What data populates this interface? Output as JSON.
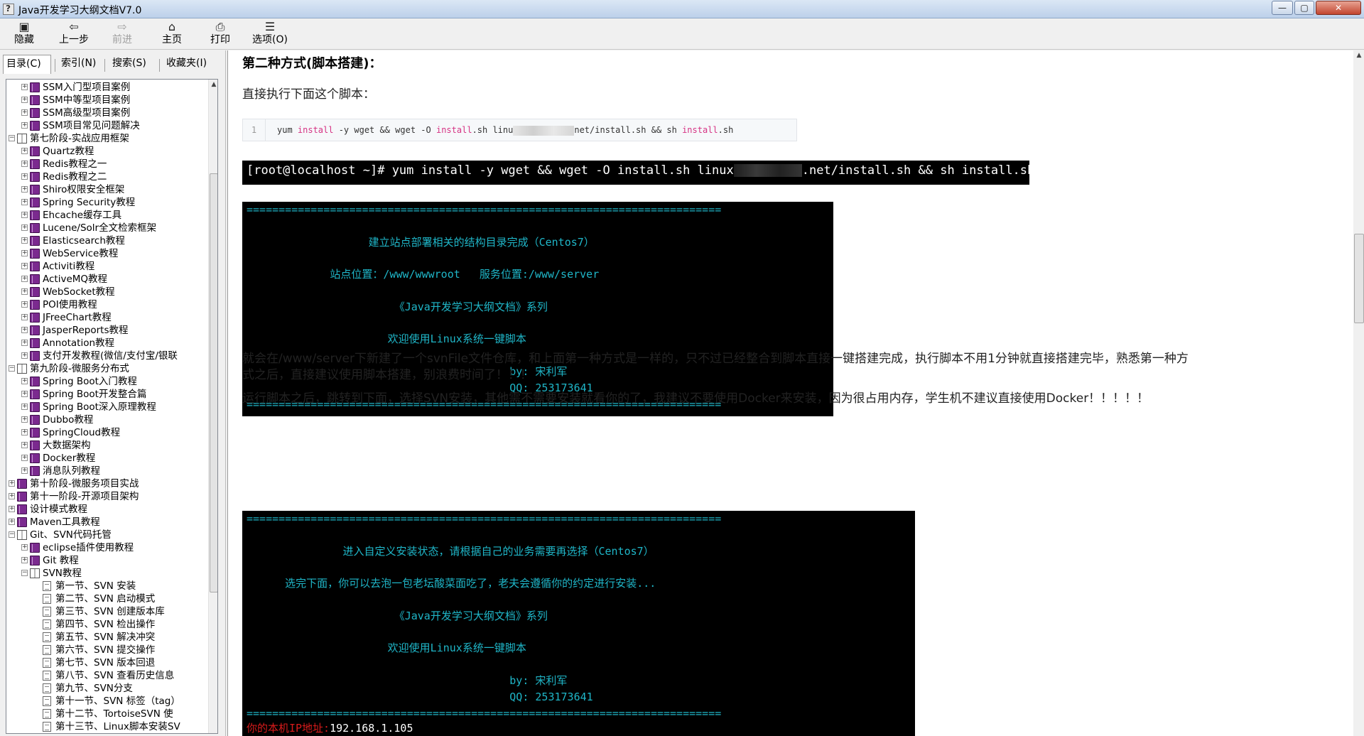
{
  "window": {
    "title": "Java开发学习大纲文档V7.0",
    "min_glyph": "—",
    "max_glyph": "▢",
    "close_glyph": "✕"
  },
  "toolbar": {
    "hide": "隐藏",
    "back": "上一步",
    "forward": "前进",
    "home": "主页",
    "print": "打印",
    "options": "选项(O)"
  },
  "nav_tabs": {
    "contents": "目录(C)",
    "index": "索引(N)",
    "search": "搜索(S)",
    "favorites": "收藏夹(I)"
  },
  "tree": [
    {
      "label": "SSM入门型项目案例",
      "level": 2,
      "icon": "book-closed"
    },
    {
      "label": "SSM中等型项目案例",
      "level": 2,
      "icon": "book-closed"
    },
    {
      "label": "SSM高级型项目案例",
      "level": 2,
      "icon": "book-closed"
    },
    {
      "label": "SSM项目常见问题解决",
      "level": 2,
      "icon": "book-closed"
    },
    {
      "label": "第七阶段-实战应用框架",
      "level": 1,
      "icon": "book-open"
    },
    {
      "label": "Quartz教程",
      "level": 2,
      "icon": "book-closed"
    },
    {
      "label": "Redis教程之一",
      "level": 2,
      "icon": "book-closed"
    },
    {
      "label": "Redis教程之二",
      "level": 2,
      "icon": "book-closed"
    },
    {
      "label": "Shiro权限安全框架",
      "level": 2,
      "icon": "book-closed"
    },
    {
      "label": "Spring Security教程",
      "level": 2,
      "icon": "book-closed"
    },
    {
      "label": "Ehcache缓存工具",
      "level": 2,
      "icon": "book-closed"
    },
    {
      "label": "Lucene/Solr全文检索框架",
      "level": 2,
      "icon": "book-closed"
    },
    {
      "label": "Elasticsearch教程",
      "level": 2,
      "icon": "book-closed"
    },
    {
      "label": "WebService教程",
      "level": 2,
      "icon": "book-closed"
    },
    {
      "label": "Activiti教程",
      "level": 2,
      "icon": "book-closed"
    },
    {
      "label": "ActiveMQ教程",
      "level": 2,
      "icon": "book-closed"
    },
    {
      "label": "WebSocket教程",
      "level": 2,
      "icon": "book-closed"
    },
    {
      "label": "POI使用教程",
      "level": 2,
      "icon": "book-closed"
    },
    {
      "label": "JFreeChart教程",
      "level": 2,
      "icon": "book-closed"
    },
    {
      "label": "JasperReports教程",
      "level": 2,
      "icon": "book-closed"
    },
    {
      "label": "Annotation教程",
      "level": 2,
      "icon": "book-closed"
    },
    {
      "label": "支付开发教程(微信/支付宝/银联",
      "level": 2,
      "icon": "book-closed"
    },
    {
      "label": "第九阶段-微服务分布式",
      "level": 1,
      "icon": "book-open"
    },
    {
      "label": "Spring Boot入门教程",
      "level": 2,
      "icon": "book-closed"
    },
    {
      "label": "Spring Boot开发整合篇",
      "level": 2,
      "icon": "book-closed"
    },
    {
      "label": "Spring Boot深入原理教程",
      "level": 2,
      "icon": "book-closed"
    },
    {
      "label": "Dubbo教程",
      "level": 2,
      "icon": "book-closed"
    },
    {
      "label": "SpringCloud教程",
      "level": 2,
      "icon": "book-closed"
    },
    {
      "label": "大数据架构",
      "level": 2,
      "icon": "book-closed"
    },
    {
      "label": "Docker教程",
      "level": 2,
      "icon": "book-closed"
    },
    {
      "label": "消息队列教程",
      "level": 2,
      "icon": "book-closed"
    },
    {
      "label": "第十阶段-微服务项目实战",
      "level": 1,
      "icon": "book-closed"
    },
    {
      "label": "第十一阶段-开源项目架构",
      "level": 1,
      "icon": "book-closed"
    },
    {
      "label": "设计模式教程",
      "level": 1,
      "icon": "book-closed"
    },
    {
      "label": "Maven工具教程",
      "level": 1,
      "icon": "book-closed"
    },
    {
      "label": "Git、SVN代码托管",
      "level": 1,
      "icon": "book-open"
    },
    {
      "label": "eclipse插件使用教程",
      "level": 2,
      "icon": "book-closed"
    },
    {
      "label": "Git 教程",
      "level": 2,
      "icon": "book-closed"
    },
    {
      "label": "SVN教程",
      "level": 2,
      "icon": "book-open"
    },
    {
      "label": "第一节、SVN 安装",
      "level": 3,
      "icon": "page"
    },
    {
      "label": "第二节、SVN 启动模式",
      "level": 3,
      "icon": "page"
    },
    {
      "label": "第三节、SVN 创建版本库",
      "level": 3,
      "icon": "page"
    },
    {
      "label": "第四节、SVN 检出操作",
      "level": 3,
      "icon": "page"
    },
    {
      "label": "第五节、SVN 解决冲突",
      "level": 3,
      "icon": "page"
    },
    {
      "label": "第六节、SVN 提交操作",
      "level": 3,
      "icon": "page"
    },
    {
      "label": "第七节、SVN 版本回退",
      "level": 3,
      "icon": "page"
    },
    {
      "label": "第八节、SVN 查看历史信息",
      "level": 3,
      "icon": "page"
    },
    {
      "label": "第九节、SVN分支",
      "level": 3,
      "icon": "page"
    },
    {
      "label": "第十一节、SVN 标签（tag）",
      "level": 3,
      "icon": "page"
    },
    {
      "label": "第十二节、TortoiseSVN 使",
      "level": 3,
      "icon": "page"
    },
    {
      "label": "第十三节、Linux脚本安装SV",
      "level": 3,
      "icon": "page"
    }
  ],
  "content": {
    "heading": "第二种方式(脚本搭建)：",
    "intro": "直接执行下面这个脚本：",
    "code": {
      "line_number": "1",
      "p1": "yum ",
      "k1": "install",
      "p2": " -y wget && wget -O ",
      "k2": "install",
      "p3": ".sh linu",
      "p4": "net/install.sh && sh ",
      "k3": "install",
      "p5": ".sh"
    },
    "cmd": {
      "left": "[root@localhost ~]# yum install -y wget && wget -O install.sh linux",
      "right": ".net/install.sh && sh install.sh",
      "cut_line": "..."
    },
    "term1": [
      "==========================================================================",
      "",
      "                   建立站点部署相关的结构目录完成（Centos7）",
      "",
      "             站点位置：/www/wwwroot   服务位置:/www/server",
      "",
      "                       《Java开发学习大纲文档》系列",
      "",
      "                      欢迎使用Linux系统一键脚本",
      "",
      "                                         by: 宋利军",
      "                                         QQ: 253173641",
      "=========================================================================="
    ],
    "para1_line1": "就会在/www/server下新建了一个svnFile文件仓库，和上面第一种方式是一样的，只不过已经整合到脚本直接一键搭建完成，执行脚本不用1分钟就直接搭建完毕，熟悉第一种方",
    "para1_line2": "式之后，直接建议使用脚本搭建，别浪费时间了！！！",
    "para2": "运行脚本之后，跳转到下面，选择SVN安装，其他需不需要安装就看你的了，我建议不要使用Docker来安装，因为很占用内存，学生机不建议直接使用Docker！！！！！",
    "term2": [
      "==========================================================================",
      "",
      "               进入自定义安装状态，请根据自己的业务需要再选择（Centos7）",
      "",
      "      选完下面，你可以去泡一包老坛酸菜面吃了，老夫会遵循你的约定进行安装...",
      "",
      "                       《Java开发学习大纲文档》系列",
      "",
      "                      欢迎使用Linux系统一键脚本",
      "",
      "                                         by: 宋利军",
      "                                         QQ: 253173641",
      "==========================================================================",
      ""
    ],
    "term2_ip_label": "你的本机IP地址:",
    "term2_ip_value": "192.168.1.105"
  }
}
